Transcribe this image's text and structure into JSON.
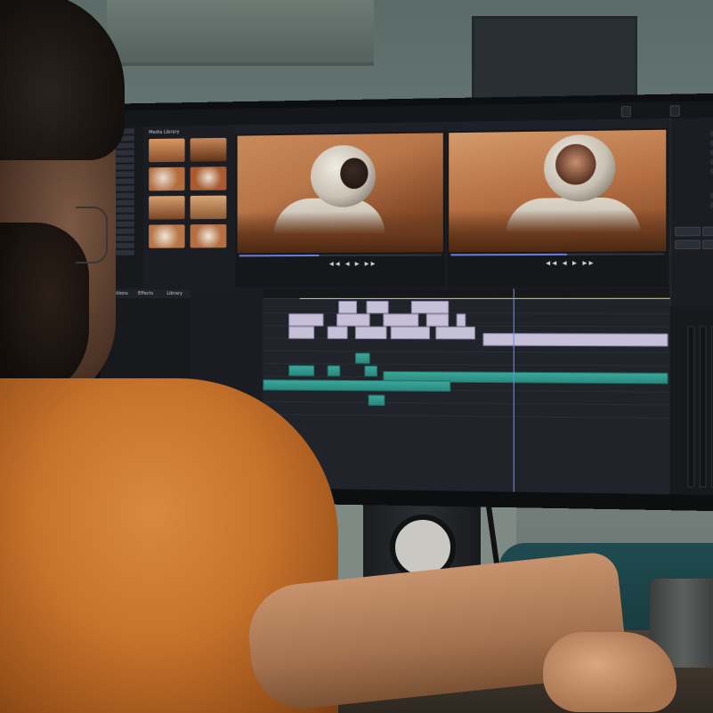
{
  "editor": {
    "title": "",
    "media_library_label": "Media Library",
    "viewer_left_label": "",
    "viewer_right_label": "",
    "mode_buttons": [
      "",
      ""
    ],
    "transport_left": "",
    "transport_controls": "◀◀ ◀ ▶ ▶▶",
    "transport_right": "",
    "tabs": [
      "Transitions",
      "Effects",
      "Library"
    ],
    "properties": {
      "rows": [
        "",
        "",
        "",
        "",
        "",
        "",
        ""
      ],
      "buttons": [
        "",
        "",
        "",
        ""
      ]
    },
    "track_headers": [
      "",
      "",
      "",
      "",
      "",
      "",
      "",
      "",
      ""
    ],
    "effects_list": [
      "",
      "",
      "",
      "",
      "",
      "",
      "",
      "",
      "",
      "",
      "",
      "",
      "",
      "",
      ""
    ]
  },
  "colors": {
    "ui_background": "#1a1c21",
    "video_clip": "#c6c0d8",
    "audio_clip": "#3aa79a",
    "playhead": "#6f86ff",
    "shirt": "#c6722b"
  }
}
